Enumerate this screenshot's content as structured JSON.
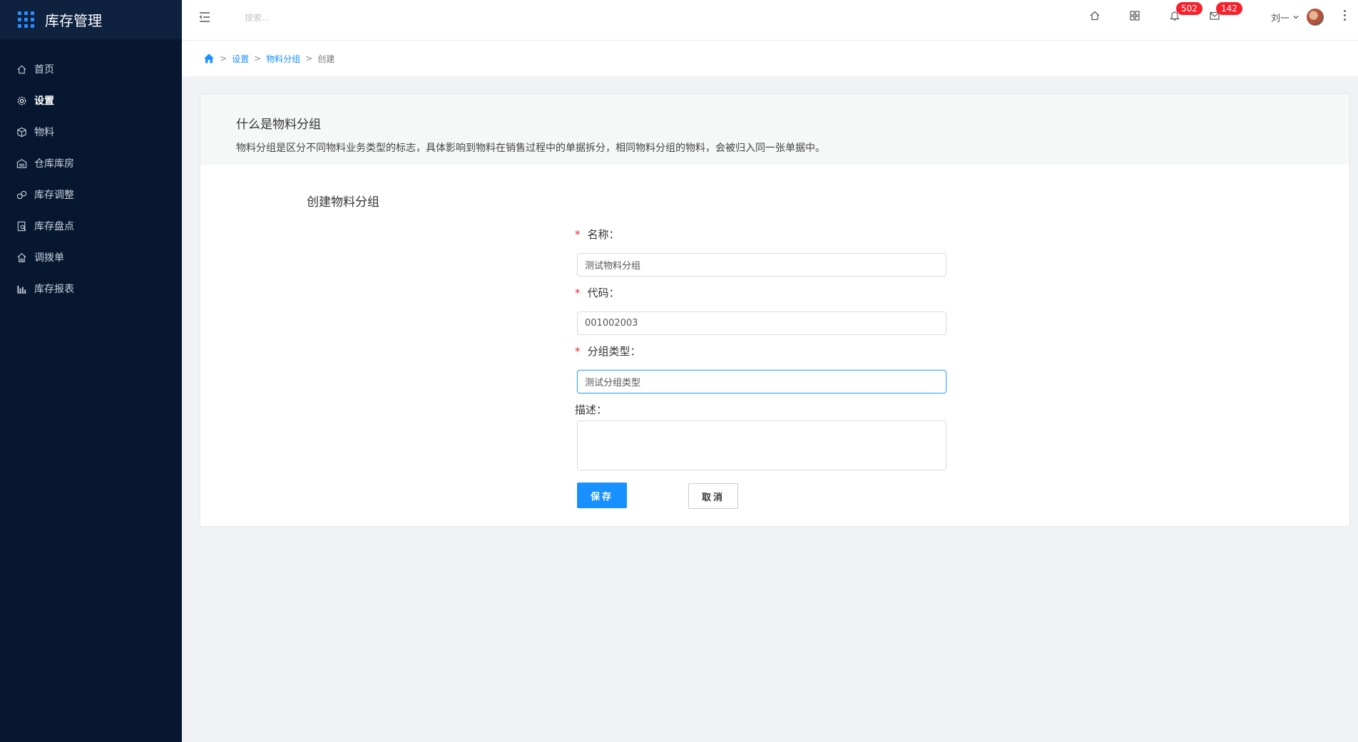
{
  "app": {
    "title": "库存管理"
  },
  "sidebar": {
    "items": [
      {
        "label": "首页",
        "icon": "home-icon"
      },
      {
        "label": "设置",
        "icon": "gear-icon"
      },
      {
        "label": "物料",
        "icon": "cube-icon"
      },
      {
        "label": "仓库库房",
        "icon": "warehouse-icon"
      },
      {
        "label": "库存调整",
        "icon": "adjust-icon"
      },
      {
        "label": "库存盘点",
        "icon": "inventory-check-icon"
      },
      {
        "label": "调拨单",
        "icon": "transfer-icon"
      },
      {
        "label": "库存报表",
        "icon": "bar-chart-icon"
      }
    ],
    "active_index": 1
  },
  "header": {
    "search_placeholder": "搜索...",
    "notifications_count": "502",
    "messages_count": "142",
    "user_name": "刘一"
  },
  "breadcrumb": {
    "items": [
      "设置",
      "物料分组"
    ],
    "current": "创建",
    "separator": ">"
  },
  "intro": {
    "title": "什么是物料分组",
    "description": "物料分组是区分不同物料业务类型的标志，具体影响到物料在销售过程中的单据拆分，相同物料分组的物料，会被归入同一张单据中。"
  },
  "form": {
    "title": "创建物料分组",
    "fields": {
      "name": {
        "label": "名称：",
        "value": "测试物料分组"
      },
      "code": {
        "label": "代码：",
        "value": "001002003"
      },
      "group_type": {
        "label": "分组类型：",
        "value": "测试分组类型"
      },
      "description": {
        "label": "描述：",
        "value": ""
      }
    },
    "save_label": "保存",
    "cancel_label": "取消"
  },
  "colors": {
    "sidebar_bg": "#071730",
    "accent": "#1890ff",
    "badge": "#f5222d"
  }
}
